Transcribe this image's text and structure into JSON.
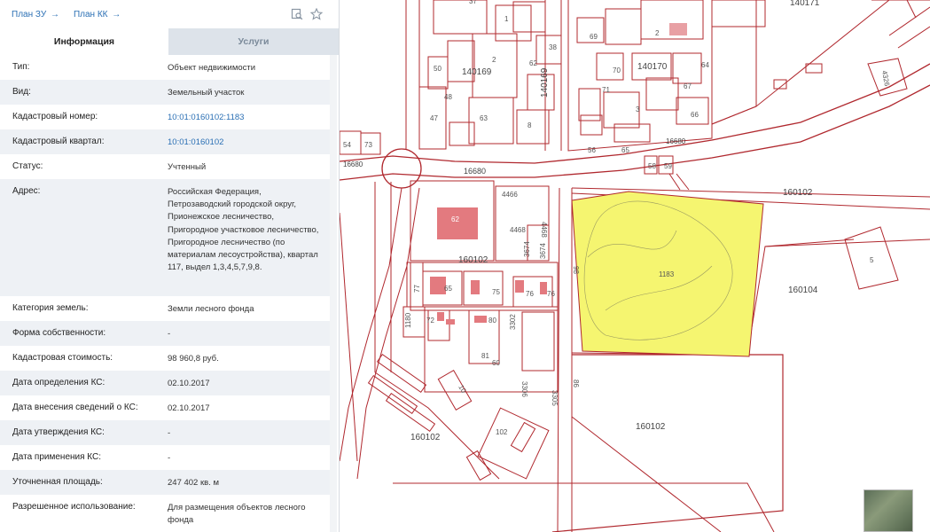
{
  "top": {
    "plan_zu": "План ЗУ",
    "plan_kk": "План КК",
    "arrow": "→"
  },
  "tabs": {
    "info": "Информация",
    "services": "Услуги"
  },
  "rows": [
    {
      "label": "Тип:",
      "value": "Объект недвижимости"
    },
    {
      "label": "Вид:",
      "value": "Земельный участок"
    },
    {
      "label": "Кадастровый номер:",
      "value": "10:01:0160102:1183",
      "link": true
    },
    {
      "label": "Кадастровый квартал:",
      "value": "10:01:0160102",
      "link": true
    },
    {
      "label": "Статус:",
      "value": "Учтенный"
    },
    {
      "label": "Адрес:",
      "value": "Российская Федерация, Петрозаводский городской округ, Прионежское лесничество, Пригородное участковое лесничество, Пригородное лесничество (по материалам лесоустройства), квартал 117, выдел 1,3,4,5,7,9,8."
    },
    {
      "label": "Категория земель:",
      "value": "Земли лесного фонда"
    },
    {
      "label": "Форма собственности:",
      "value": "-"
    },
    {
      "label": "Кадастровая стоимость:",
      "value": "98 960,8 руб."
    },
    {
      "label": "Дата определения КС:",
      "value": "02.10.2017"
    },
    {
      "label": "Дата внесения сведений о КС:",
      "value": "02.10.2017"
    },
    {
      "label": "Дата утверждения КС:",
      "value": "-"
    },
    {
      "label": "Дата применения КС:",
      "value": "-"
    },
    {
      "label": "Уточненная площадь:",
      "value": "247 402 кв. м"
    },
    {
      "label": "Разрешенное использование:",
      "value": "Для размещения объектов лесного фонда"
    }
  ],
  "map": {
    "labels": {
      "q140171": "140171",
      "q140169a": "140169",
      "q140169b": "140169",
      "q140170": "140170",
      "q160102a": "160102",
      "q160102b": "160102",
      "q160102c": "160102",
      "q160102d": "160102",
      "q160102e": "160102",
      "q160104": "160104",
      "r16680a": "16680",
      "r16680b": "16680",
      "r16680c": "16680",
      "p1183": "1183",
      "p62": "62",
      "p4468a": "4468",
      "p4468b": "4468",
      "p4466": "4466",
      "p3674a": "3674",
      "p3674b": "3674",
      "p65": "65",
      "p75": "75",
      "p76a": "76",
      "p76b": "76",
      "p80": "80",
      "p81": "81",
      "p60": "60",
      "p3302": "3302",
      "p3305": "3305",
      "p3306": "3306",
      "p5": "5",
      "p4326": "4326",
      "p63": "63",
      "p47": "47",
      "p48": "48",
      "p50": "50",
      "p37": "37",
      "p1": "1",
      "p2a": "2",
      "p2b": "2",
      "p3": "3",
      "p8": "8",
      "p38": "38",
      "p62b": "62",
      "p71": "71",
      "p70": "70",
      "p69": "69",
      "p67": "67",
      "p66": "66",
      "p64": "64",
      "p65b": "65",
      "p56": "56",
      "p58": "58",
      "p59": "59",
      "p73": "73",
      "p54": "54",
      "p86": "86",
      "p98": "98",
      "p1180": "1180",
      "p77": "77",
      "p102": "102",
      "p10": "10",
      "p72": "72"
    },
    "colors": {
      "boundary": "#b0282e",
      "selected_fill": "#f5f570",
      "building": "#e37a7f"
    }
  }
}
